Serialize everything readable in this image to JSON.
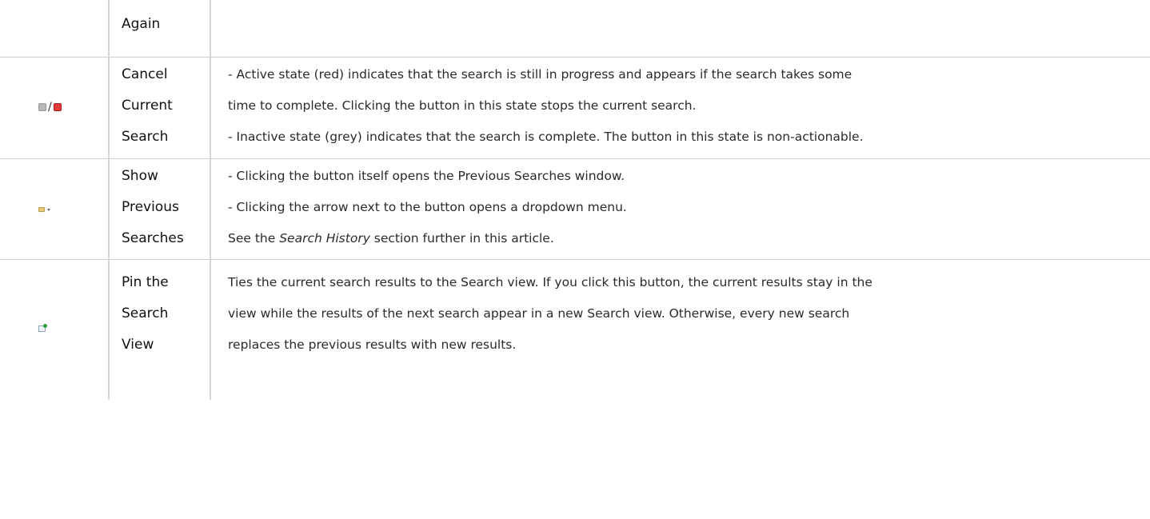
{
  "rows": [
    {
      "name_lines": [
        "Again"
      ],
      "desc_lines": []
    },
    {
      "icon": "cancel-search-icons",
      "name_lines": [
        "Cancel",
        "Current",
        "Search"
      ],
      "desc_lines": [
        "- Active state (red) indicates that the search is still in progress and appears if the search takes some",
        "time to complete. Clicking the button in this state stops the current search.",
        "- Inactive state (grey) indicates that the search is complete. The button in this state is non-actionable."
      ],
      "icon_separator": "/"
    },
    {
      "icon": "previous-searches-icon",
      "name_lines": [
        "Show",
        "Previous",
        "Searches"
      ],
      "desc_lines": [
        "- Clicking the button itself opens the Previous Searches window.",
        "- Clicking the arrow next to the button opens a dropdown menu."
      ],
      "desc_see": {
        "before": "See the ",
        "italic": "Search History",
        "after": " section further in this article."
      }
    },
    {
      "icon": "pin-search-view-icon",
      "name_lines": [
        "Pin the",
        "Search",
        "View"
      ],
      "desc_lines": [
        "Ties the current search results to the Search view. If you click this button, the current results stay in the",
        "view while the results of the next search appear in a new Search view. Otherwise, every new search",
        "replaces the previous results with new results."
      ]
    }
  ],
  "colors": {
    "border": "#d5d5d5",
    "stop_active": "#e23a3a",
    "stop_inactive": "#b8b8b8"
  }
}
